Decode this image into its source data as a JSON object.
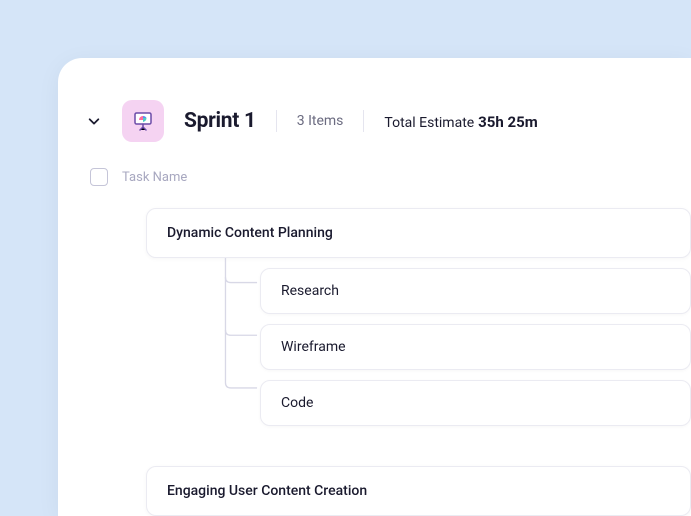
{
  "sprint": {
    "title": "Sprint 1",
    "item_count": "3 Items",
    "estimate_label": "Total Estimate",
    "estimate_value": "35h 25m"
  },
  "columns": {
    "task_name": "Task Name"
  },
  "tasks": [
    {
      "name": "Dynamic Content Planning",
      "subtasks": [
        {
          "name": "Research"
        },
        {
          "name": "Wireframe"
        },
        {
          "name": "Code"
        }
      ]
    },
    {
      "name": "Engaging User Content Creation",
      "subtasks": []
    }
  ]
}
